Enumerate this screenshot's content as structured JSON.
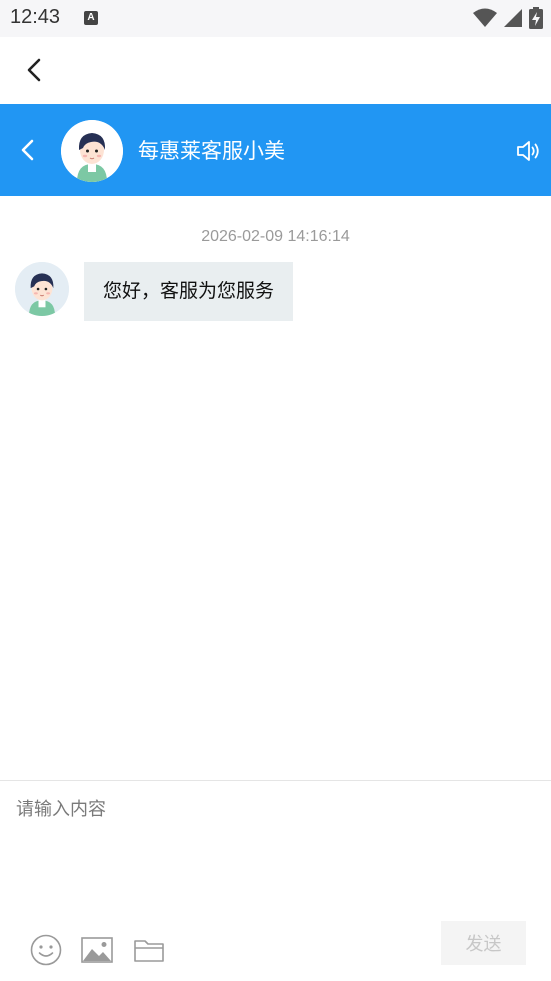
{
  "status_bar": {
    "time": "12:43",
    "notification_badge": "A",
    "icons": [
      "wifi-icon",
      "signal-icon",
      "battery-charging-icon"
    ]
  },
  "top_bar": {
    "back_icon": "chevron-left-icon"
  },
  "chat_header": {
    "title": "每惠莱客服小美",
    "back_icon": "chevron-left-icon",
    "sound_icon": "speaker-icon",
    "background_color": "#2196f3"
  },
  "messages": [
    {
      "timestamp": "2026-02-09 14:16:14",
      "sender": "agent",
      "text": "您好，客服为您服务"
    }
  ],
  "composer": {
    "placeholder": "请输入内容",
    "value": "",
    "send_label": "发送",
    "tools": [
      "emoji-icon",
      "image-icon",
      "folder-icon"
    ]
  }
}
